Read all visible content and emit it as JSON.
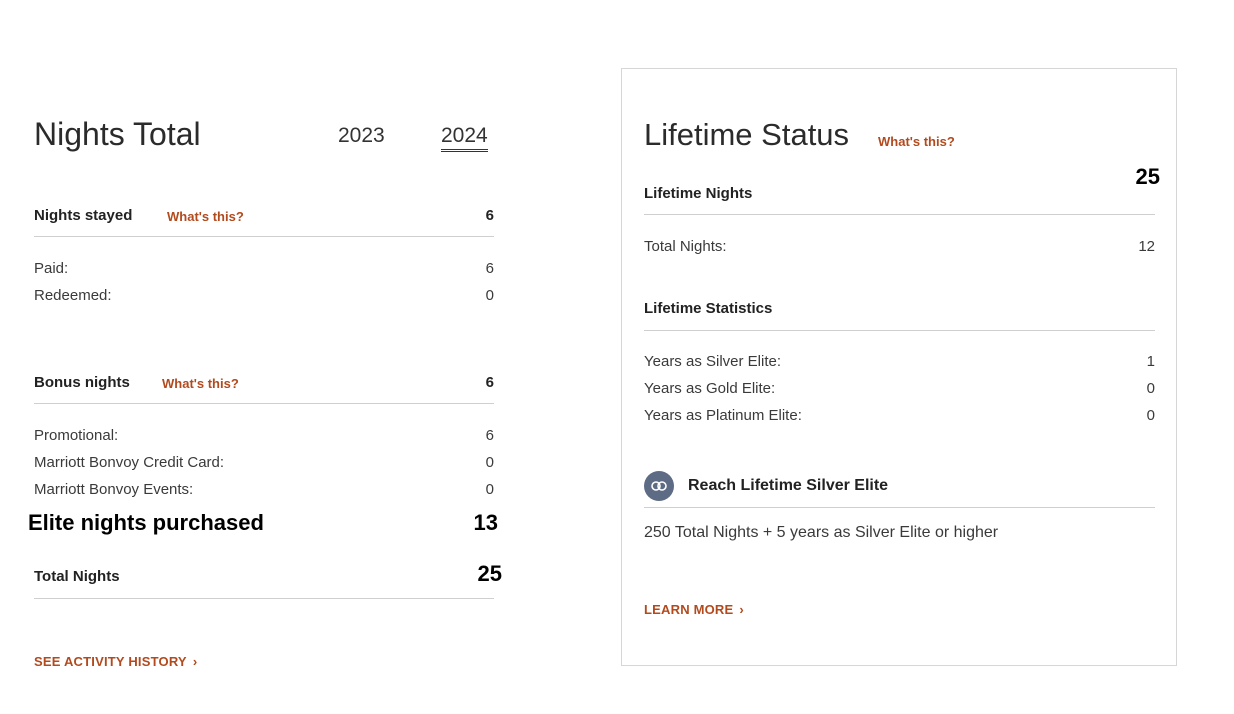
{
  "nights_total": {
    "title": "Nights Total",
    "year_tabs": [
      "2023",
      "2024"
    ],
    "nights_stayed": {
      "label": "Nights stayed",
      "whats_this": "What's this?",
      "value": "6",
      "rows": [
        {
          "label": "Paid:",
          "value": "6"
        },
        {
          "label": "Redeemed:",
          "value": "0"
        }
      ]
    },
    "bonus_nights": {
      "label": "Bonus nights",
      "whats_this": "What's this?",
      "value": "6",
      "rows": [
        {
          "label": "Promotional:",
          "value": "6"
        },
        {
          "label": "Marriott Bonvoy Credit Card:",
          "value": "0"
        },
        {
          "label": "Marriott Bonvoy Events:",
          "value": "0"
        }
      ]
    },
    "elite_nights_purchased": {
      "label": "Elite nights purchased",
      "value": "13"
    },
    "total_nights": {
      "label": "Total Nights",
      "value": "25"
    },
    "activity_link": "SEE ACTIVITY HISTORY"
  },
  "lifetime_status": {
    "title": "Lifetime Status",
    "whats_this": "What's this?",
    "lifetime_nights": {
      "label": "Lifetime Nights",
      "value": "25"
    },
    "total_nights_row": {
      "label": "Total Nights:",
      "value": "12"
    },
    "lifetime_statistics": {
      "label": "Lifetime Statistics",
      "rows": [
        {
          "label": "Years as Silver Elite:",
          "value": "1"
        },
        {
          "label": "Years as Gold Elite:",
          "value": "0"
        },
        {
          "label": "Years as Platinum Elite:",
          "value": "0"
        }
      ]
    },
    "goal": {
      "title": "Reach Lifetime Silver Elite",
      "requirement": "250 Total Nights + 5 years as Silver Elite or higher",
      "icon": "silver-elite-medal-icon"
    },
    "learn_more": "LEARN MORE"
  },
  "colors": {
    "accent": "#b24a1e",
    "medal": "#5d6b84",
    "rule": "#cfcfcf"
  }
}
